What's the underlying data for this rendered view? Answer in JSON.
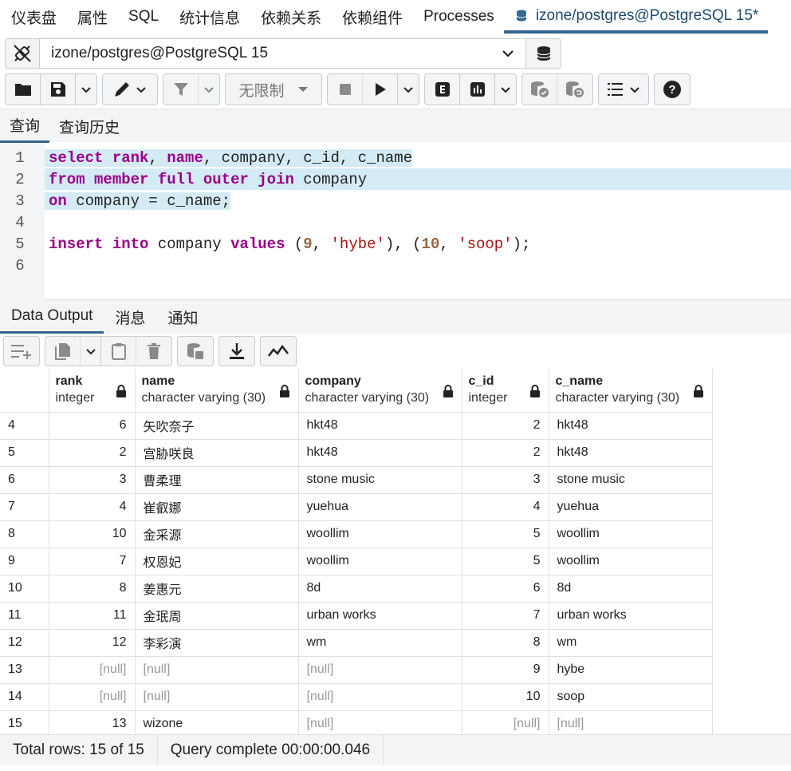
{
  "tabs": [
    {
      "label": "仪表盘"
    },
    {
      "label": "属性"
    },
    {
      "label": "SQL"
    },
    {
      "label": "统计信息"
    },
    {
      "label": "依赖关系"
    },
    {
      "label": "依赖组件"
    },
    {
      "label": "Processes"
    },
    {
      "label": "izone/postgres@PostgreSQL 15*",
      "icon": "database-icon",
      "active": true
    }
  ],
  "connection": {
    "value": "izone/postgres@PostgreSQL 15"
  },
  "toolbar": {
    "limit_label": "无限制"
  },
  "query_tabs": [
    "查询",
    "查询历史"
  ],
  "editor": {
    "lines": [
      "select rank, name, company, c_id, c_name",
      "from member full outer join company",
      "on company = c_name;",
      "",
      "insert into company values (9, 'hybe'), (10, 'soop');",
      ""
    ]
  },
  "output_tabs": [
    "Data Output",
    "消息",
    "通知"
  ],
  "grid": {
    "columns": [
      {
        "name": "rank",
        "type": "integer"
      },
      {
        "name": "name",
        "type": "character varying (30)"
      },
      {
        "name": "company",
        "type": "character varying (30)"
      },
      {
        "name": "c_id",
        "type": "integer"
      },
      {
        "name": "c_name",
        "type": "character varying (30)"
      }
    ],
    "rows": [
      {
        "n": "4",
        "cells": [
          "6",
          "矢吹奈子",
          "hkt48",
          "2",
          "hkt48"
        ]
      },
      {
        "n": "5",
        "cells": [
          "2",
          "宫胁咲良",
          "hkt48",
          "2",
          "hkt48"
        ]
      },
      {
        "n": "6",
        "cells": [
          "3",
          "曹柔理",
          "stone music",
          "3",
          "stone music"
        ]
      },
      {
        "n": "7",
        "cells": [
          "4",
          "崔叡娜",
          "yuehua",
          "4",
          "yuehua"
        ]
      },
      {
        "n": "8",
        "cells": [
          "10",
          "金采源",
          "woollim",
          "5",
          "woollim"
        ]
      },
      {
        "n": "9",
        "cells": [
          "7",
          "权恩妃",
          "woollim",
          "5",
          "woollim"
        ]
      },
      {
        "n": "10",
        "cells": [
          "8",
          "姜惠元",
          "8d",
          "6",
          "8d"
        ]
      },
      {
        "n": "11",
        "cells": [
          "11",
          "金珉周",
          "urban works",
          "7",
          "urban works"
        ]
      },
      {
        "n": "12",
        "cells": [
          "12",
          "李彩演",
          "wm",
          "8",
          "wm"
        ]
      },
      {
        "n": "13",
        "cells": [
          "[null]",
          "[null]",
          "[null]",
          "9",
          "hybe"
        ]
      },
      {
        "n": "14",
        "cells": [
          "[null]",
          "[null]",
          "[null]",
          "10",
          "soop"
        ]
      },
      {
        "n": "15",
        "cells": [
          "13",
          "wizone",
          "[null]",
          "[null]",
          "[null]"
        ]
      }
    ]
  },
  "status": {
    "total_rows": "Total rows: 15 of 15",
    "query_time": "Query complete 00:00:00.046"
  },
  "colors": {
    "accent": "#326690",
    "selection": "#d4ebf6",
    "keyword": "#990088"
  }
}
